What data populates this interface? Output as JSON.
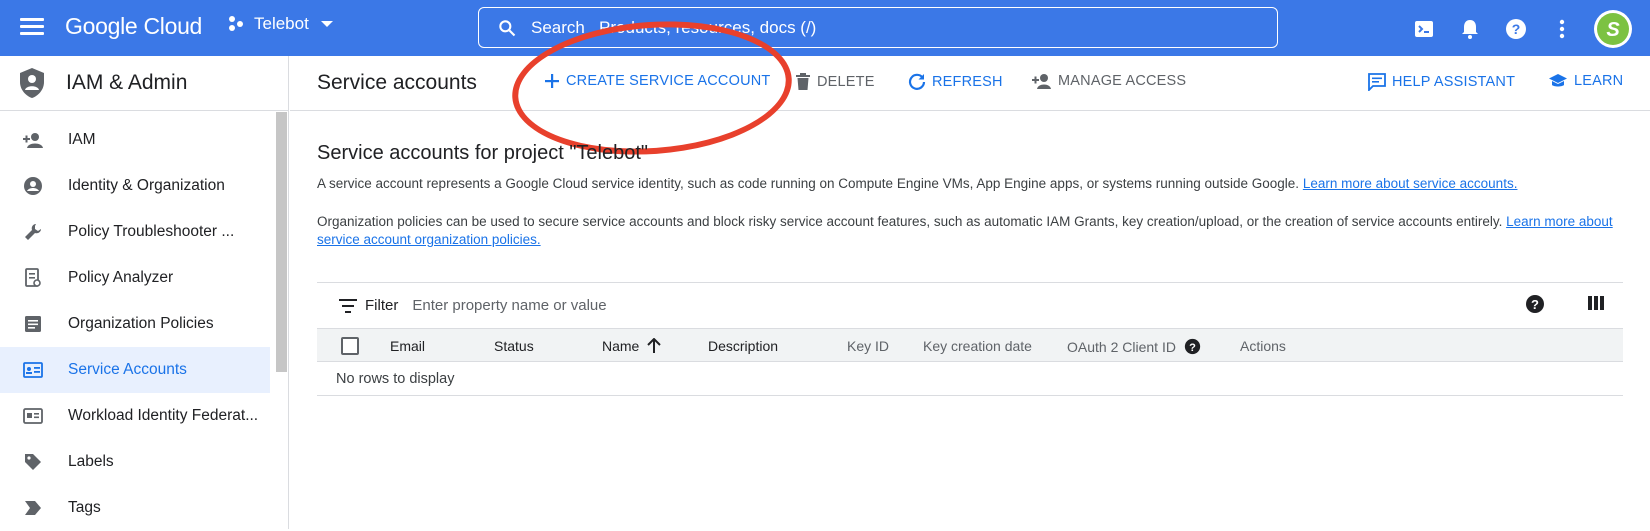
{
  "topbar": {
    "brand": "Google Cloud",
    "project": "Telebot",
    "search_placeholder": "Search   Products, resources, docs (/)",
    "avatar_letter": "S"
  },
  "nav": {
    "title": "IAM & Admin",
    "items": [
      {
        "label": "IAM",
        "icon": "person-add-icon"
      },
      {
        "label": "Identity & Organization",
        "icon": "account-circle-icon"
      },
      {
        "label": "Policy Troubleshooter ...",
        "icon": "wrench-icon"
      },
      {
        "label": "Policy Analyzer",
        "icon": "policy-analyzer-icon"
      },
      {
        "label": "Organization Policies",
        "icon": "document-list-icon"
      },
      {
        "label": "Service Accounts",
        "icon": "service-account-icon"
      },
      {
        "label": "Workload Identity Federat...",
        "icon": "id-card-icon"
      },
      {
        "label": "Labels",
        "icon": "label-tag-icon"
      },
      {
        "label": "Tags",
        "icon": "tag-chevron-icon"
      }
    ]
  },
  "toolbar": {
    "page_title": "Service accounts",
    "create": "CREATE SERVICE ACCOUNT",
    "delete": "DELETE",
    "refresh": "REFRESH",
    "manage_access": "MANAGE ACCESS",
    "help_assistant": "HELP ASSISTANT",
    "learn": "LEARN"
  },
  "main": {
    "heading": "Service accounts for project \"Telebot\"",
    "p1_text": "A service account represents a Google Cloud service identity, such as code running on Compute Engine VMs, App Engine apps, or systems running outside Google.",
    "p1_link": "Learn more about service accounts.",
    "p2_text": "Organization policies can be used to secure service accounts and block risky service account features, such as automatic IAM Grants, key creation/upload, or the creation of service accounts entirely.",
    "p2_link": "Learn more about service account organization policies.",
    "filter_label": "Filter",
    "filter_placeholder": "Enter property name or value",
    "columns": [
      "Email",
      "Status",
      "Name",
      "Description",
      "Key ID",
      "Key creation date",
      "OAuth 2 Client ID",
      "Actions"
    ],
    "empty": "No rows to display"
  },
  "colors": {
    "topbar": "#3b78e7",
    "accent": "#1a73e8",
    "annotation": "#e8402c"
  }
}
